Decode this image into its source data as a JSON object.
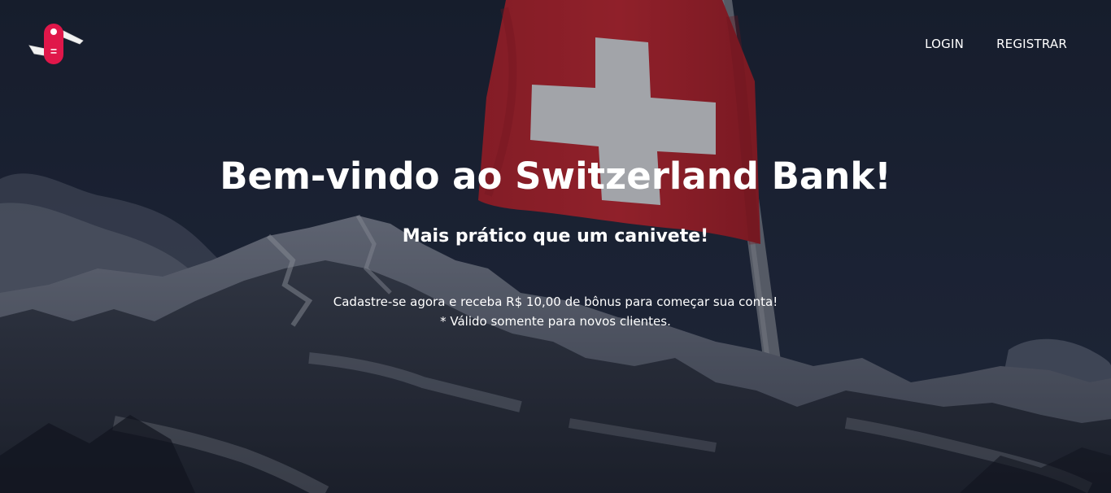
{
  "nav": {
    "login_label": "LOGIN",
    "register_label": "REGISTRAR"
  },
  "hero": {
    "title": "Bem-vindo ao Switzerland Bank!",
    "subtitle": "Mais prático que um canivete!",
    "promo_text": "Cadastre-se agora e receba R$ 10,00 de bônus para começar sua conta!",
    "promo_note": "* Válido somente para novos clientes."
  },
  "colors": {
    "brand_red": "#e0174a",
    "flag_red": "#d8282e",
    "sky": "#1b2233",
    "text": "#ffffff"
  },
  "icons": {
    "logo": "swiss-army-knife-icon"
  }
}
